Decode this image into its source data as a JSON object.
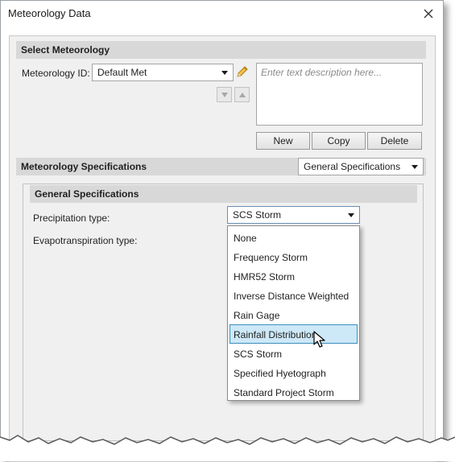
{
  "window": {
    "title": "Meteorology Data"
  },
  "select_section": {
    "header": "Select Meteorology",
    "id_label": "Meteorology ID:",
    "id_value": "Default Met",
    "description_placeholder": "Enter text description here...",
    "buttons": {
      "new": "New",
      "copy": "Copy",
      "delete": "Delete"
    }
  },
  "spec_section": {
    "header": "Meteorology Specifications",
    "view_value": "General Specifications"
  },
  "general_section": {
    "header": "General Specifications",
    "precip_label": "Precipitation type:",
    "precip_value": "SCS Storm",
    "evapo_label": "Evapotranspiration type:"
  },
  "dropdown": {
    "options": [
      "None",
      "Frequency Storm",
      "HMR52 Storm",
      "Inverse Distance Weighted",
      "Rain Gage",
      "Rainfall Distribution",
      "SCS Storm",
      "Specified Hyetograph",
      "Standard Project Storm"
    ],
    "highlighted": "Rainfall Distribution"
  },
  "icons": {
    "close": "close-icon",
    "edit": "pencil-icon",
    "move_down": "arrow-down-icon",
    "move_up": "arrow-up-icon",
    "pointer": "mouse-pointer-icon"
  },
  "colors": {
    "section_header_bg": "#d8d8d8",
    "highlight_bg": "#cde8f7",
    "highlight_border": "#3c8dbc",
    "pencil": "#e0a020"
  }
}
